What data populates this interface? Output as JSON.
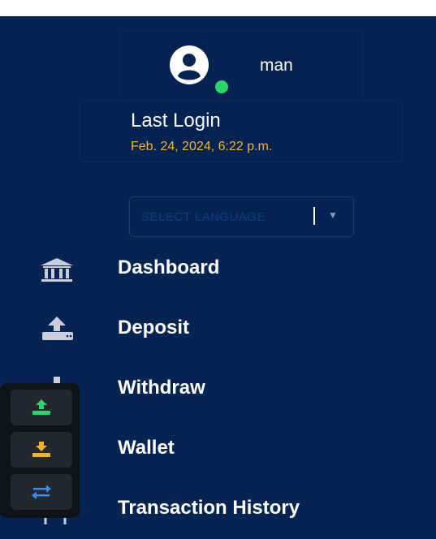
{
  "user": {
    "name": "man",
    "status_color": "#2dd46b"
  },
  "last_login": {
    "label": "Last Login",
    "date": "Feb. 24, 2024, 6:22 p.m."
  },
  "language_select": {
    "placeholder": "SELECT LANGUAGE",
    "separator": "|"
  },
  "nav": {
    "items": [
      {
        "label": "Dashboard",
        "icon": "bank-icon"
      },
      {
        "label": "Deposit",
        "icon": "upload-tray-icon"
      },
      {
        "label": "Withdraw",
        "icon": "download-tray-icon"
      },
      {
        "label": "Wallet",
        "icon": "wallet-icon"
      },
      {
        "label": "Transaction History",
        "icon": "document-icon"
      }
    ]
  },
  "quick_actions": [
    {
      "icon": "deposit-icon",
      "color": "#2dd46b"
    },
    {
      "icon": "withdraw-icon",
      "color": "#f4b42a"
    },
    {
      "icon": "transfer-arrows-icon",
      "color": "#3b8cf0"
    }
  ],
  "colors": {
    "sidebar_bg": "#062451",
    "accent": "#f4b42a"
  }
}
